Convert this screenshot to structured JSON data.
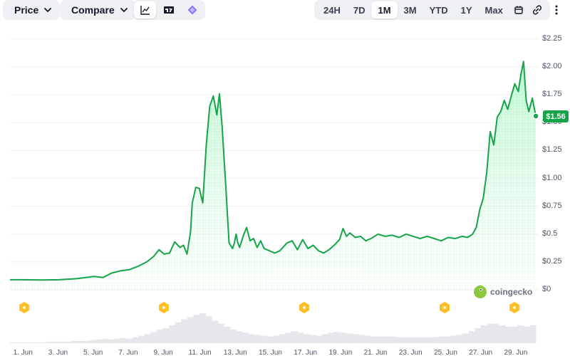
{
  "toolbar": {
    "price_label": "Price",
    "compare_label": "Compare",
    "views": [
      {
        "icon": "line-chart-icon",
        "active": true
      },
      {
        "icon": "tradingview-icon",
        "active": false
      },
      {
        "icon": "diamond-icon",
        "active": false
      }
    ],
    "ranges": [
      {
        "label": "24H",
        "active": false
      },
      {
        "label": "7D",
        "active": false
      },
      {
        "label": "1M",
        "active": true
      },
      {
        "label": "3M",
        "active": false
      },
      {
        "label": "YTD",
        "active": false
      },
      {
        "label": "1Y",
        "active": false
      },
      {
        "label": "Max",
        "active": false
      }
    ],
    "extra_icons": [
      "calendar-icon",
      "link-icon",
      "more-vertical-icon"
    ]
  },
  "current_price": "$1.56",
  "watermark": "coingecko",
  "colors": {
    "line": "#16a34a",
    "fill_top": "#bbf7d0",
    "volume": "#e5e7eb",
    "event": "#fbbf24"
  },
  "event_markers": [
    "1 Jun",
    "9 Jun",
    "17 Jun",
    "25 Jun",
    "29 Jun"
  ],
  "chart_data": {
    "type": "area",
    "title": "",
    "ylabel": "",
    "xlabel": "",
    "ylim": [
      0,
      2.25
    ],
    "y_ticks": [
      "$2.25",
      "$2.00",
      "$1.75",
      "$1.50",
      "$1.25",
      "$1.00",
      "$0.75",
      "$0.5",
      "$0.25",
      "$0"
    ],
    "y_tick_values": [
      2.25,
      2.0,
      1.75,
      1.5,
      1.25,
      1.0,
      0.75,
      0.5,
      0.25,
      0
    ],
    "x_ticks": [
      "1. Jun",
      "3. Jun",
      "5. Jun",
      "7. Jun",
      "9. Jun",
      "11. Jun",
      "13. Jun",
      "15. Jun",
      "17. Jun",
      "19. Jun",
      "21. Jun",
      "23. Jun",
      "25. Jun",
      "27. Jun",
      "29. Jun"
    ],
    "x_tick_days": [
      1,
      3,
      5,
      7,
      9,
      11,
      13,
      15,
      17,
      19,
      21,
      23,
      25,
      27,
      29
    ],
    "x_range_days": [
      0.2,
      30.2
    ],
    "grid": true,
    "legend": "none",
    "series": [
      {
        "x": [
          0.2,
          1.0,
          2.0,
          3.0,
          4.0,
          5.0,
          5.5,
          6.0,
          6.5,
          7.0,
          7.5,
          8.0,
          8.4,
          8.7,
          9.0,
          9.3,
          9.6,
          9.9,
          10.1,
          10.3,
          10.5,
          10.6,
          10.8,
          11.0,
          11.2,
          11.4,
          11.6,
          11.8,
          12.0,
          12.15,
          12.3,
          12.5,
          12.7,
          12.9,
          13.0,
          13.1,
          13.2,
          13.3,
          13.5,
          13.7,
          13.9,
          14.1,
          14.3,
          14.5,
          14.7,
          15.0,
          15.3,
          15.6,
          16.0,
          16.3,
          16.6,
          16.9,
          17.2,
          17.5,
          17.8,
          18.1,
          18.4,
          18.7,
          19.0,
          19.2,
          19.4,
          19.6,
          19.9,
          20.2,
          20.5,
          20.8,
          21.2,
          21.6,
          22.0,
          22.4,
          22.8,
          23.2,
          23.6,
          24.0,
          24.4,
          24.8,
          25.2,
          25.6,
          26.0,
          26.3,
          26.6,
          26.8,
          27.0,
          27.2,
          27.4,
          27.6,
          27.8,
          28.0,
          28.2,
          28.4,
          28.6,
          28.8,
          29.0,
          29.2,
          29.35,
          29.5,
          29.65,
          29.8,
          30.0,
          30.2
        ],
        "values": [
          0.09,
          0.09,
          0.088,
          0.09,
          0.1,
          0.12,
          0.11,
          0.15,
          0.17,
          0.18,
          0.21,
          0.25,
          0.3,
          0.36,
          0.32,
          0.33,
          0.43,
          0.38,
          0.4,
          0.32,
          0.52,
          0.78,
          0.92,
          0.91,
          0.78,
          1.3,
          1.65,
          1.74,
          1.57,
          1.76,
          1.47,
          0.96,
          0.42,
          0.37,
          0.42,
          0.5,
          0.42,
          0.38,
          0.48,
          0.56,
          0.44,
          0.46,
          0.38,
          0.44,
          0.37,
          0.35,
          0.33,
          0.35,
          0.42,
          0.44,
          0.36,
          0.45,
          0.37,
          0.4,
          0.35,
          0.33,
          0.36,
          0.4,
          0.45,
          0.55,
          0.48,
          0.51,
          0.47,
          0.48,
          0.44,
          0.46,
          0.5,
          0.48,
          0.49,
          0.47,
          0.5,
          0.48,
          0.46,
          0.48,
          0.46,
          0.44,
          0.47,
          0.46,
          0.48,
          0.47,
          0.5,
          0.56,
          0.72,
          0.82,
          1.05,
          1.42,
          1.3,
          1.55,
          1.6,
          1.7,
          1.62,
          1.74,
          1.85,
          1.78,
          1.93,
          2.05,
          1.7,
          1.6,
          1.72,
          1.56
        ]
      }
    ],
    "volume": [
      1,
      1,
      1,
      1,
      1,
      1,
      2,
      2,
      2,
      2,
      3,
      3,
      3,
      4,
      5,
      6,
      5,
      6,
      7,
      6,
      8,
      10,
      12,
      15,
      18,
      20,
      24,
      28,
      32,
      35,
      38,
      40,
      36,
      30,
      26,
      22,
      18,
      16,
      14,
      12,
      11,
      10,
      9,
      10,
      12,
      14,
      16,
      14,
      12,
      11,
      10,
      12,
      14,
      15,
      14,
      13,
      12,
      11,
      10,
      9,
      9,
      9,
      9,
      8,
      8,
      8,
      8,
      8,
      8,
      8,
      9,
      9,
      10,
      11,
      13,
      16,
      20,
      24,
      26,
      26,
      24,
      22,
      22,
      24,
      22,
      24
    ]
  }
}
